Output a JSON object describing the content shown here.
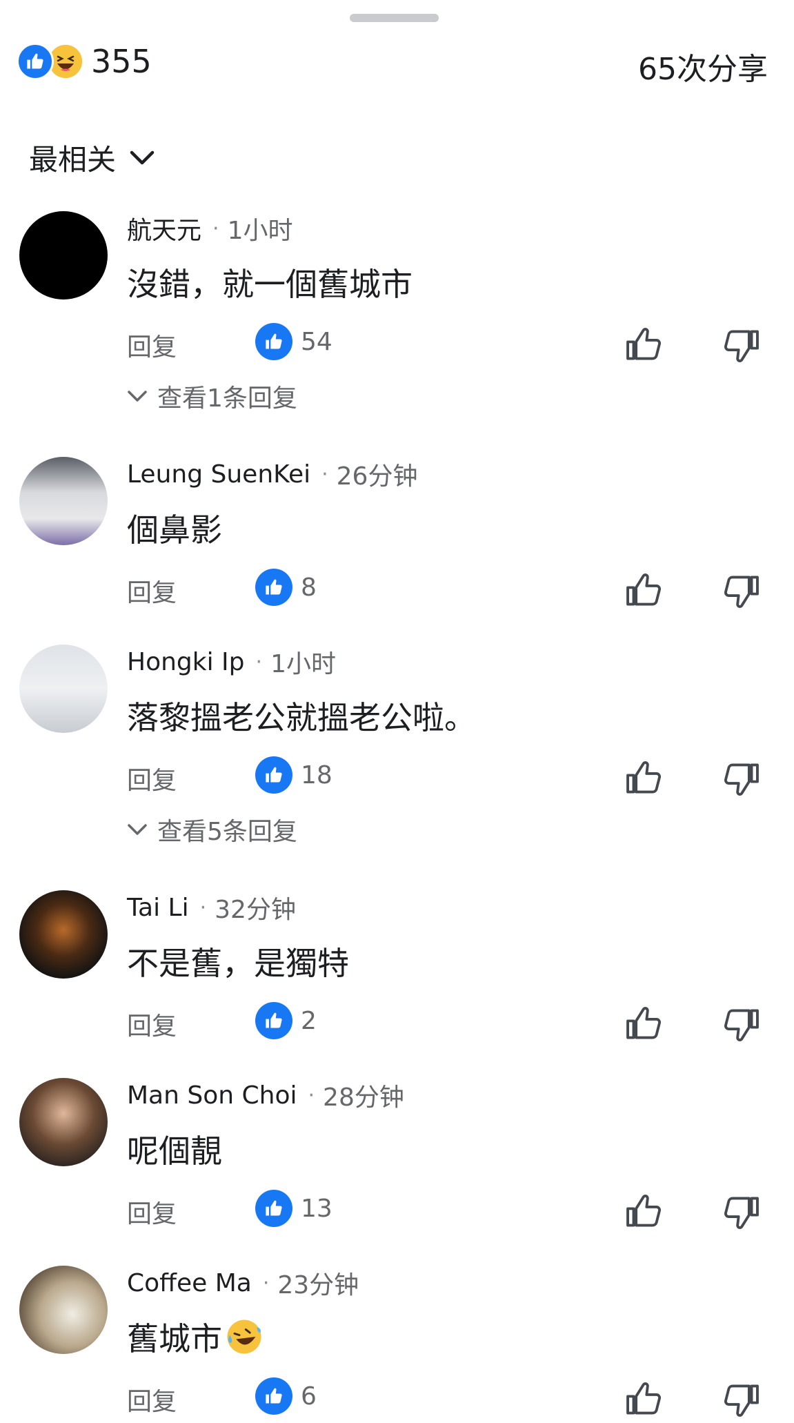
{
  "header": {
    "reaction_count": "355",
    "shares": "65次分享",
    "reaction_icons": [
      "like-icon",
      "haha-icon"
    ]
  },
  "sort": {
    "label": "最相关"
  },
  "actions": {
    "reply_label": "回复"
  },
  "colors": {
    "like_blue": "#1877f2",
    "secondary_text": "#65676b",
    "primary_text": "#1c1e21"
  },
  "comments": [
    {
      "name": "航天元",
      "time": "1小时",
      "text": "沒錯，就一個舊城市",
      "likes": "54",
      "view_replies": "查看1条回复"
    },
    {
      "name": "Leung SuenKei",
      "time": "26分钟",
      "text": "個鼻影",
      "likes": "8"
    },
    {
      "name": "Hongki Ip",
      "time": "1小时",
      "text": "落黎搵老公就搵老公啦。",
      "likes": "18",
      "view_replies": "查看5条回复"
    },
    {
      "name": "Tai Li",
      "time": "32分钟",
      "text": "不是舊，是獨特",
      "likes": "2"
    },
    {
      "name": "Man Son Choi",
      "time": "28分钟",
      "text": "呢個靚",
      "likes": "13"
    },
    {
      "name": "Coffee Ma",
      "time": "23分钟",
      "text": "舊城市",
      "text_emoji": "laughing-crying-emoji",
      "likes": "6"
    }
  ]
}
